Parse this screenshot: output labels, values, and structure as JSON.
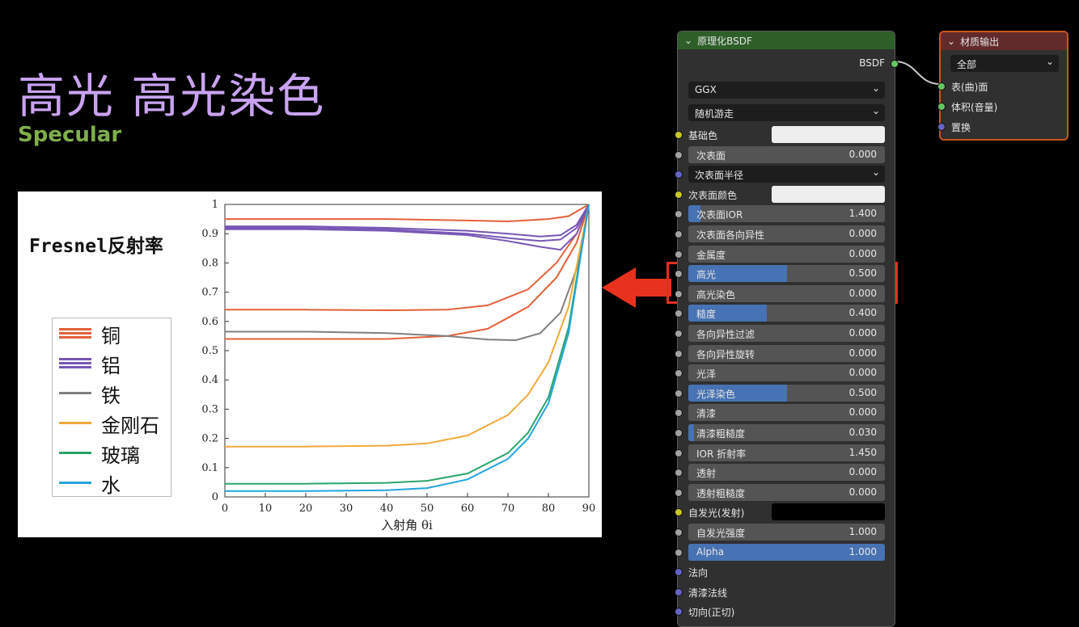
{
  "title": "高光 高光染色",
  "subtitle": "Specular",
  "figure": {
    "title": "Fresnel反射率",
    "legend": [
      {
        "label": "铜",
        "color": "#e4613a",
        "lines": 3
      },
      {
        "label": "铝",
        "color": "#7857b5",
        "lines": 3
      },
      {
        "label": "铁",
        "color": "#808080",
        "lines": 1
      },
      {
        "label": "金刚石",
        "color": "#f0a93b",
        "lines": 1
      },
      {
        "label": "玻璃",
        "color": "#2aa56b",
        "lines": 1
      },
      {
        "label": "水",
        "color": "#23a6dc",
        "lines": 1
      }
    ]
  },
  "chart_data": {
    "type": "line",
    "xlabel": "入射角 θi",
    "ylabel": "",
    "xlim": [
      0,
      90
    ],
    "ylim": [
      0,
      1
    ],
    "x_ticks": [
      "0",
      "10",
      "20",
      "30",
      "40",
      "50",
      "60",
      "70",
      "80",
      "90"
    ],
    "y_ticks": [
      "0",
      "0.1",
      "0.2",
      "0.3",
      "0.4",
      "0.5",
      "0.6",
      "0.7",
      "0.8",
      "0.9",
      "1"
    ],
    "grid": false,
    "series": [
      {
        "name": "铜",
        "color": "#e4613a",
        "points": [
          [
            0,
            0.95
          ],
          [
            20,
            0.95
          ],
          [
            40,
            0.95
          ],
          [
            60,
            0.945
          ],
          [
            70,
            0.942
          ],
          [
            80,
            0.95
          ],
          [
            85,
            0.96
          ],
          [
            90,
            1.0
          ]
        ]
      },
      {
        "name": "铜",
        "color": "#e4613a",
        "points": [
          [
            0,
            0.64
          ],
          [
            20,
            0.64
          ],
          [
            40,
            0.638
          ],
          [
            55,
            0.64
          ],
          [
            65,
            0.655
          ],
          [
            75,
            0.71
          ],
          [
            82,
            0.8
          ],
          [
            87,
            0.9
          ],
          [
            90,
            1.0
          ]
        ]
      },
      {
        "name": "铜",
        "color": "#e4613a",
        "points": [
          [
            0,
            0.54
          ],
          [
            20,
            0.54
          ],
          [
            40,
            0.54
          ],
          [
            55,
            0.55
          ],
          [
            65,
            0.575
          ],
          [
            75,
            0.65
          ],
          [
            82,
            0.75
          ],
          [
            87,
            0.87
          ],
          [
            90,
            1.0
          ]
        ]
      },
      {
        "name": "铝",
        "color": "#7857b5",
        "points": [
          [
            0,
            0.925
          ],
          [
            20,
            0.925
          ],
          [
            40,
            0.92
          ],
          [
            60,
            0.91
          ],
          [
            70,
            0.9
          ],
          [
            78,
            0.89
          ],
          [
            83,
            0.895
          ],
          [
            87,
            0.93
          ],
          [
            90,
            1.0
          ]
        ]
      },
      {
        "name": "铝",
        "color": "#7857b5",
        "points": [
          [
            0,
            0.92
          ],
          [
            20,
            0.92
          ],
          [
            40,
            0.915
          ],
          [
            60,
            0.9
          ],
          [
            70,
            0.885
          ],
          [
            78,
            0.875
          ],
          [
            83,
            0.88
          ],
          [
            87,
            0.92
          ],
          [
            90,
            1.0
          ]
        ]
      },
      {
        "name": "铝",
        "color": "#7857b5",
        "points": [
          [
            0,
            0.915
          ],
          [
            20,
            0.915
          ],
          [
            40,
            0.91
          ],
          [
            60,
            0.895
          ],
          [
            70,
            0.875
          ],
          [
            78,
            0.855
          ],
          [
            83,
            0.845
          ],
          [
            87,
            0.9
          ],
          [
            90,
            1.0
          ]
        ]
      },
      {
        "name": "铁",
        "color": "#808080",
        "points": [
          [
            0,
            0.565
          ],
          [
            20,
            0.565
          ],
          [
            40,
            0.56
          ],
          [
            55,
            0.55
          ],
          [
            65,
            0.538
          ],
          [
            72,
            0.536
          ],
          [
            78,
            0.56
          ],
          [
            83,
            0.63
          ],
          [
            87,
            0.78
          ],
          [
            90,
            1.0
          ]
        ]
      },
      {
        "name": "金刚石",
        "color": "#f0a93b",
        "points": [
          [
            0,
            0.172
          ],
          [
            20,
            0.172
          ],
          [
            40,
            0.175
          ],
          [
            50,
            0.183
          ],
          [
            60,
            0.21
          ],
          [
            70,
            0.28
          ],
          [
            75,
            0.35
          ],
          [
            80,
            0.46
          ],
          [
            85,
            0.65
          ],
          [
            90,
            1.0
          ]
        ]
      },
      {
        "name": "玻璃",
        "color": "#2aa56b",
        "points": [
          [
            0,
            0.045
          ],
          [
            20,
            0.045
          ],
          [
            40,
            0.048
          ],
          [
            50,
            0.055
          ],
          [
            60,
            0.08
          ],
          [
            70,
            0.15
          ],
          [
            75,
            0.22
          ],
          [
            80,
            0.34
          ],
          [
            85,
            0.58
          ],
          [
            90,
            1.0
          ]
        ]
      },
      {
        "name": "水",
        "color": "#23a6dc",
        "points": [
          [
            0,
            0.02
          ],
          [
            20,
            0.02
          ],
          [
            40,
            0.023
          ],
          [
            50,
            0.03
          ],
          [
            60,
            0.06
          ],
          [
            70,
            0.13
          ],
          [
            75,
            0.2
          ],
          [
            80,
            0.32
          ],
          [
            85,
            0.56
          ],
          [
            90,
            1.0
          ]
        ]
      }
    ]
  },
  "bsdf_node": {
    "title": "原理化BSDF",
    "output": "BSDF",
    "distribution": "GGX",
    "subsurface_method": "随机游走",
    "rows": [
      {
        "kind": "color",
        "label": "基础色",
        "socket": "yellow",
        "color": "#eeeeee"
      },
      {
        "kind": "value",
        "label": "次表面",
        "value": "0.000",
        "socket": "grey",
        "fill": 0
      },
      {
        "kind": "dropdown",
        "label": "次表面半径",
        "socket": "purple"
      },
      {
        "kind": "color",
        "label": "次表面颜色",
        "socket": "yellow",
        "color": "#eeeeee"
      },
      {
        "kind": "value",
        "label": "次表面IOR",
        "value": "1.400",
        "socket": "grey",
        "fill": 0.06
      },
      {
        "kind": "value",
        "label": "次表面各向异性",
        "value": "0.000",
        "socket": "grey",
        "fill": 0
      },
      {
        "kind": "value",
        "label": "金属度",
        "value": "0.000",
        "socket": "grey",
        "fill": 0
      },
      {
        "kind": "value",
        "label": "高光",
        "value": "0.500",
        "socket": "grey",
        "fill": 0.5
      },
      {
        "kind": "value",
        "label": "高光染色",
        "value": "0.000",
        "socket": "grey",
        "fill": 0
      },
      {
        "kind": "value",
        "label": "糙度",
        "value": "0.400",
        "socket": "grey",
        "fill": 0.4
      },
      {
        "kind": "value",
        "label": "各向异性过滤",
        "value": "0.000",
        "socket": "grey",
        "fill": 0
      },
      {
        "kind": "value",
        "label": "各向异性旋转",
        "value": "0.000",
        "socket": "grey",
        "fill": 0
      },
      {
        "kind": "value",
        "label": "光泽",
        "value": "0.000",
        "socket": "grey",
        "fill": 0
      },
      {
        "kind": "value",
        "label": "光泽染色",
        "value": "0.500",
        "socket": "grey",
        "fill": 0.5
      },
      {
        "kind": "value",
        "label": "清漆",
        "value": "0.000",
        "socket": "grey",
        "fill": 0
      },
      {
        "kind": "value",
        "label": "清漆粗糙度",
        "value": "0.030",
        "socket": "grey",
        "fill": 0.03
      },
      {
        "kind": "value",
        "label": "IOR 折射率",
        "value": "1.450",
        "socket": "grey",
        "fill": 0
      },
      {
        "kind": "value",
        "label": "透射",
        "value": "0.000",
        "socket": "grey",
        "fill": 0
      },
      {
        "kind": "value",
        "label": "透射粗糙度",
        "value": "0.000",
        "socket": "grey",
        "fill": 0
      },
      {
        "kind": "color",
        "label": "自发光(发射)",
        "socket": "yellow",
        "color": "#000000"
      },
      {
        "kind": "value",
        "label": "自发光强度",
        "value": "1.000",
        "socket": "grey",
        "fill": 0
      },
      {
        "kind": "value",
        "label": "Alpha",
        "value": "1.000",
        "socket": "grey",
        "fill": 1
      },
      {
        "kind": "plain",
        "label": "法向",
        "socket": "purple"
      },
      {
        "kind": "plain",
        "label": "清漆法线",
        "socket": "purple"
      },
      {
        "kind": "plain",
        "label": "切向(正切)",
        "socket": "purple"
      }
    ]
  },
  "output_node": {
    "title": "材质输出",
    "target": "全部",
    "inputs": [
      {
        "label": "表(曲)面",
        "socket": "green"
      },
      {
        "label": "体积(音量)",
        "socket": "green"
      },
      {
        "label": "置换",
        "socket": "purple"
      }
    ]
  },
  "colors": {
    "title": "#c9a3f2",
    "subtitle": "#7fae4b",
    "highlight": "#e03020",
    "arrow": "#e8321e",
    "bsdf_header": "#2e5f29",
    "output_header": "#612b2b",
    "slider_fill": "#4772b3"
  }
}
